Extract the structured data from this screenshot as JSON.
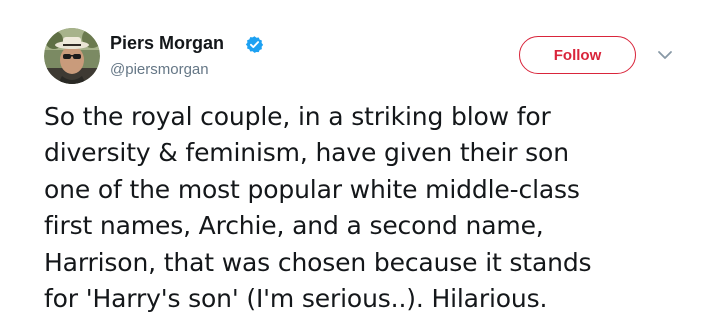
{
  "tweet": {
    "author": {
      "name": "Piers Morgan",
      "handle": "@piersmorgan",
      "verified": true,
      "avatar_icon": "profile-photo"
    },
    "follow_button": {
      "label": "Follow",
      "color": "#d9253b"
    },
    "menu_icon": "chevron-down-icon",
    "text_lines": [
      "So the royal couple, in a striking blow for",
      "diversity & feminism, have given their son",
      "one of the most popular white middle-class",
      "first names, Archie, and a second name,",
      "Harrison, that was chosen because it stands",
      "for 'Harry's son' (I'm serious..). Hilarious."
    ]
  },
  "colors": {
    "text": "#14171a",
    "secondary_text": "#657786",
    "verified_badge": "#1da1f2",
    "accent": "#d9253b"
  }
}
